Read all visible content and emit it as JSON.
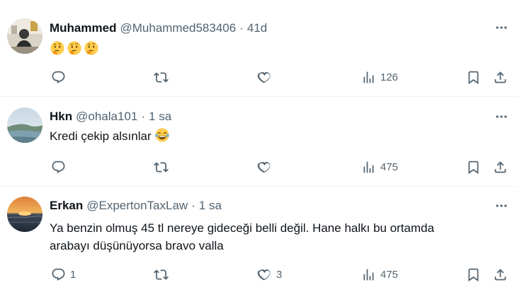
{
  "colors": {
    "text": "#0f1419",
    "secondary": "#536471",
    "divider": "#eff3f4"
  },
  "icons": {
    "reply": "reply-icon",
    "retweet": "retweet-icon",
    "like": "heart-icon",
    "views": "views-chart-icon",
    "bookmark": "bookmark-icon",
    "share": "share-icon",
    "more": "more-dots-icon"
  },
  "tweets": [
    {
      "name": "Muhammed",
      "handle": "@Muhammed583406",
      "separator": "·",
      "time": "41d",
      "text": "",
      "emojis": [
        "🤔",
        "🤔",
        "🤔"
      ],
      "replies": "",
      "retweets": "",
      "likes": "",
      "views": "126"
    },
    {
      "name": "Hkn",
      "handle": "@ohala101",
      "separator": "·",
      "time": "1 sa",
      "text": "Kredi çekip alsınlar",
      "emojis": [
        "😂"
      ],
      "replies": "",
      "retweets": "",
      "likes": "",
      "views": "475"
    },
    {
      "name": "Erkan",
      "handle": "@ExpertonTaxLaw",
      "separator": "·",
      "time": "1 sa",
      "text": "Ya benzin olmuş 45 tl nereye gideceği belli değil. Hane halkı bu ortamda arabayı düşünüyorsa bravo valla",
      "emojis": [],
      "replies": "1",
      "retweets": "",
      "likes": "3",
      "views": "475"
    }
  ]
}
